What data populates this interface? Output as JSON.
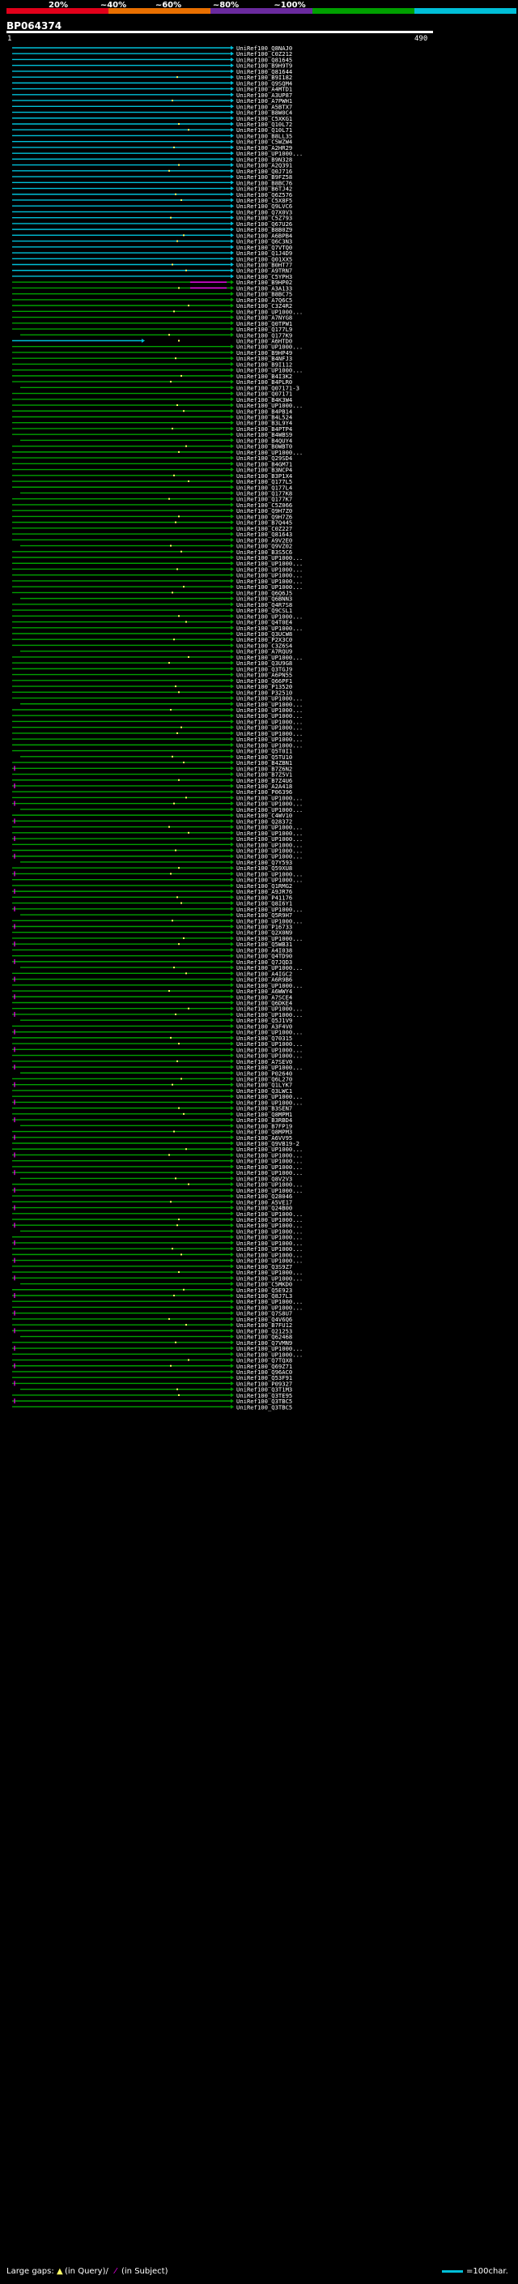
{
  "query": {
    "name": "BP064374",
    "start_label": "1",
    "end_label": "490"
  },
  "scale": {
    "labels": [
      "20%",
      "~40%",
      "~60%",
      "~80%",
      "~100%"
    ],
    "colors": [
      "#e1001a",
      "#e86f00",
      "#6a2a9e",
      "#00a000",
      "#00bfd8"
    ]
  },
  "legend": {
    "large_gaps_label": "Large gaps:",
    "in_query_label": "(in Query)/",
    "in_subject_label": "(in Subject)",
    "scale_label": "=100char."
  },
  "colors": {
    "top_hits": "#00bfd8",
    "other_hits": "#00a000",
    "query_gap": "#ff00ff",
    "insert_marker": "#ffff66",
    "outline_mark": "#4488ff"
  },
  "chart_data": {
    "type": "alignment",
    "query_length": 490,
    "subjects": [
      "UniRef100_Q8NAJ0",
      "UniRef100_C0Z212",
      "UniRef100_Q81645",
      "UniRef100_B9H9T9",
      "UniRef100_Q81644",
      "UniRef100_B9I182",
      "UniRef100_Q9SQM4",
      "UniRef100_A4MTD1",
      "UniRef100_A3UP87",
      "UniRef100_A7PWH1",
      "UniRef100_A5BTX7",
      "UniRef100_B8W0C4",
      "UniRef100_C5XKG1",
      "UniRef100_Q10L72",
      "UniRef100_Q10L71",
      "UniRef100_B8LL35",
      "UniRef100_C5WZW4",
      "UniRef100_A2HR29",
      "UniRef100_UP1000...",
      "UniRef100_B9N328",
      "UniRef100_A2Q391",
      "UniRef100_Q0J716",
      "UniRef100_B9FZ58",
      "UniRef100_B8BC76",
      "UniRef100_B6TJ42",
      "UniRef100_Q6Z576",
      "UniRef100_C5X8F5",
      "UniRef100_Q9LVC6",
      "UniRef100_Q7X0V3",
      "UniRef100_C5Z793",
      "UniRef100_Q67U26",
      "UniRef100_B8B0Z9",
      "UniRef100_A6BPB4",
      "UniRef100_Q6C3N3",
      "UniRef100_Q7VTQ0",
      "UniRef100_Q1J4D9",
      "UniRef100_Q01XX5",
      "UniRef100_B0HT77",
      "UniRef100_A9TRN7",
      "UniRef100_C5YPH3",
      "UniRef100_B9HP02",
      "UniRef100_A3A133",
      "UniRef100_B8BC75",
      "UniRef100_A7Q6C5",
      "UniRef100_C3Z4R2",
      "UniRef100_UP1000...",
      "UniRef100_A7NYG8",
      "UniRef100_Q0TPW1",
      "UniRef100_Q177L9",
      "UniRef100_Q177K9",
      "UniRef100_A6HTD0",
      "UniRef100_UP1000...",
      "UniRef100_B9HP49",
      "UniRef100_B4NFJ3",
      "UniRef100_B9I112",
      "UniRef100_UP1000...",
      "UniRef100_B4I3K2",
      "UniRef100_B4PLR0",
      "UniRef100_Q07171-3",
      "UniRef100_Q07171",
      "UniRef100_B4K3W4",
      "UniRef100_UP1000...",
      "UniRef100_B4PB14",
      "UniRef100_B4L524",
      "UniRef100_B3L9Y4",
      "UniRef100_B4PTP4",
      "UniRef100_B4WBS9",
      "UniRef100_B4QUY4",
      "UniRef100_B0WBT0",
      "UniRef100_UP1000...",
      "UniRef100_Q29SD4",
      "UniRef100_B4GM71",
      "UniRef100_B3NCP4",
      "UniRef100_B3P1X4",
      "UniRef100_Q177L5",
      "UniRef100_Q177L4",
      "UniRef100_Q177K8",
      "UniRef100_Q177K7",
      "UniRef100_C5Z066",
      "UniRef100_Q9H7Z0",
      "UniRef100_Q9H7Z6",
      "UniRef100_B7Q445",
      "UniRef100_C0Z227",
      "UniRef100_Q81643",
      "UniRef100_A9V2E0",
      "UniRef100_Q9VZ02",
      "UniRef100_B3S5C6",
      "UniRef100_UP1000...",
      "UniRef100_UP1000...",
      "UniRef100_UP1000...",
      "UniRef100_UP1000...",
      "UniRef100_UP1000...",
      "UniRef100_UP1000...",
      "UniRef100_Q6Q6J5",
      "UniRef100_Q6BNN3",
      "UniRef100_Q4R7S8",
      "UniRef100_Q9CSL1",
      "UniRef100_UP1000...",
      "UniRef100_Q4T0E4",
      "UniRef100_UP1000...",
      "UniRef100_Q3UCW8",
      "UniRef100_P2X3C0",
      "UniRef100_C3Z6S4",
      "UniRef100_A7RQU9",
      "UniRef100_UP1000...",
      "UniRef100_Q3U9G8",
      "UniRef100_Q3TGJ9",
      "UniRef100_A6PN55",
      "UniRef100_Q66PF1",
      "UniRef100_P13520",
      "UniRef100_P32510",
      "UniRef100_UP1000...",
      "UniRef100_UP1000...",
      "UniRef100_UP1000...",
      "UniRef100_UP1000...",
      "UniRef100_UP1000...",
      "UniRef100_UP1000...",
      "UniRef100_UP1000...",
      "UniRef100_UP1000...",
      "UniRef100_UP1000...",
      "UniRef100_Q5T0I1",
      "UniRef100_Q5TU10",
      "UniRef100_B4ZBN1",
      "UniRef100_B7Z6N2",
      "UniRef100_B7Z5V1",
      "UniRef100_B7Z4U6",
      "UniRef100_A2A418",
      "UniRef100_P06396",
      "UniRef100_UP1000...",
      "UniRef100_UP1000...",
      "UniRef100_UP1000...",
      "UniRef100_C4WV10",
      "UniRef100_Q28372",
      "UniRef100_UP1000...",
      "UniRef100_UP1000...",
      "UniRef100_UP1000...",
      "UniRef100_UP1000...",
      "UniRef100_UP1000...",
      "UniRef100_UP1000...",
      "UniRef100_Q7Y593",
      "UniRef100_Q59XU8",
      "UniRef100_UP1000...",
      "UniRef100_UP1000...",
      "UniRef100_Q1RMG2",
      "UniRef100_A9JR76",
      "UniRef100_P41176",
      "UniRef100_Q8I6Y1",
      "UniRef100_UP1000...",
      "UniRef100_Q5R9H7",
      "UniRef100_UP1000...",
      "UniRef100_P16733",
      "UniRef100_Q2X0N9",
      "UniRef100_UP1000...",
      "UniRef100_Q5WB31",
      "UniRef100_A4I038",
      "UniRef100_Q4TD90",
      "UniRef100_Q7JQD3",
      "UniRef100_UP1000...",
      "UniRef100_A4IGC2",
      "UniRef100_A6R9B6",
      "UniRef100_UP1000...",
      "UniRef100_A6WWY4",
      "UniRef100_A7SCE4",
      "UniRef100_Q6DKE4",
      "UniRef100_UP1000...",
      "UniRef100_UP1000...",
      "UniRef100_Q5J1V9",
      "UniRef100_A3F4V0",
      "UniRef100_UP1000...",
      "UniRef100_Q70315",
      "UniRef100_UP1000...",
      "UniRef100_UP1000...",
      "UniRef100_UP1000...",
      "UniRef100_A7SEV0",
      "UniRef100_UP1000...",
      "UniRef100_P02640",
      "UniRef100_Q6L270",
      "UniRef100_Q1LYK7",
      "UniRef100_Q3LWC1",
      "UniRef100_UP1000...",
      "UniRef100_UP1000...",
      "UniRef100_B3SEN7",
      "UniRef100_Q8MPM1",
      "UniRef100_B3RBD4",
      "UniRef100_B7FP19",
      "UniRef100_Q8MPM3",
      "UniRef100_A6VV95",
      "UniRef100_Q9VB19-2",
      "UniRef100_UP1000...",
      "UniRef100_UP1000...",
      "UniRef100_UP1000...",
      "UniRef100_UP1000...",
      "UniRef100_UP1000...",
      "UniRef100_Q8V2V3",
      "UniRef100_UP1000...",
      "UniRef100_UP1000...",
      "UniRef100_Q28046",
      "UniRef100_A5VE17",
      "UniRef100_Q24B00",
      "UniRef100_UP1000...",
      "UniRef100_UP1000...",
      "UniRef100_UP1000...",
      "UniRef100_UP1000...",
      "UniRef100_UP1000...",
      "UniRef100_UP1000...",
      "UniRef100_UP1000...",
      "UniRef100_UP1000...",
      "UniRef100_UP1000...",
      "UniRef100_Q3S9Z7",
      "UniRef100_UP1000...",
      "UniRef100_UP1000...",
      "UniRef100_C5MKD0",
      "UniRef100_Q5E923",
      "UniRef100_Q8J7L3",
      "UniRef100_UP1000...",
      "UniRef100_UP1000...",
      "UniRef100_Q7S8U7",
      "UniRef100_Q4V6Q6",
      "UniRef100_B7FU12",
      "UniRef100_Q21253",
      "UniRef100_Q62468",
      "UniRef100_Q7VMN9",
      "UniRef100_UP1000...",
      "UniRef100_UP1000...",
      "UniRef100_Q7TQX8",
      "UniRef100_Q69Z71",
      "UniRef100_Q96AC0",
      "UniRef100_Q53F91",
      "UniRef100_P09327",
      "UniRef100_Q3T1M3",
      "UniRef100_Q3TE95",
      "UniRef100_Q3TBC5",
      "UniRef100_Q3TBC5"
    ]
  }
}
